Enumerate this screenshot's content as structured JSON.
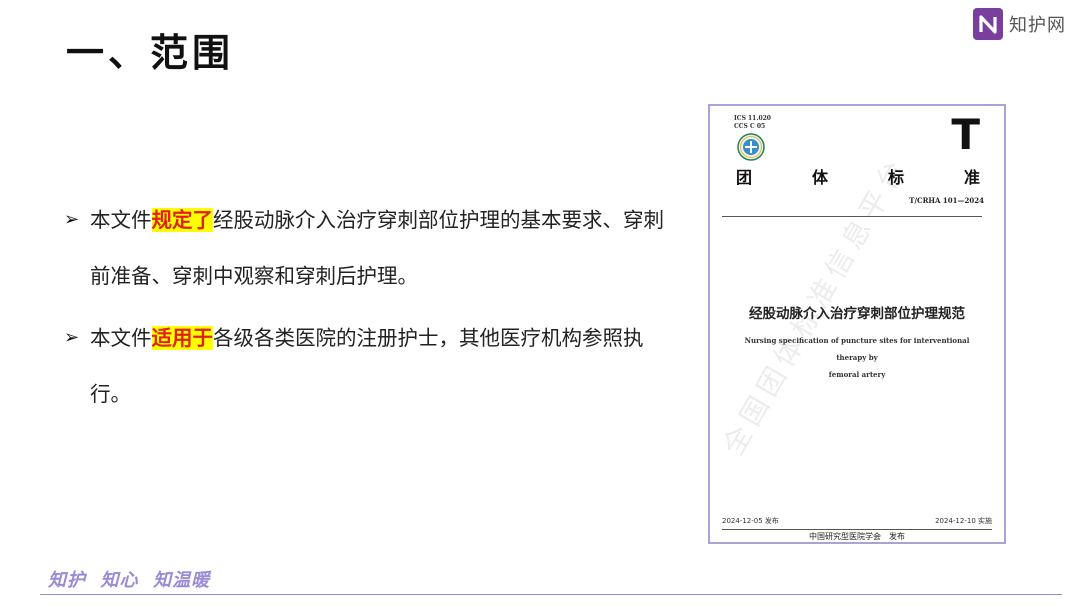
{
  "slide": {
    "title": "一、范围"
  },
  "logo": {
    "mark": "N",
    "text": "知护网",
    "icon": "zhihu-logo-icon",
    "color": "#7a3f9c"
  },
  "bullets": [
    {
      "before": "本文件",
      "highlight": "规定了",
      "after": "经股动脉介入治疗穿刺部位护理的基本要求、穿刺前准备、穿刺中观察和穿刺后护理。"
    },
    {
      "before": "本文件",
      "highlight": "适用于",
      "after": "各级各类医院的注册护士，其他医疗机构参照执行。"
    }
  ],
  "bullet_marker": "➢",
  "highlight_colors": {
    "background": "#ffff00",
    "text": "#e0201b"
  },
  "document": {
    "ics": "ICS 11.020",
    "ccs": "CCS C 05",
    "category_letter": "T",
    "category": [
      "团",
      "体",
      "标",
      "准"
    ],
    "standard_no": "T/CRHA 101—2024",
    "title_cn": "经股动脉介入治疗穿刺部位护理规范",
    "title_en_line1": "Nursing specification of puncture sites for interventional therapy by",
    "title_en_line2": "femoral artery",
    "publish_date": "2024-12-05 发布",
    "effective_date": "2024-12-10 实施",
    "publisher": "中国研究型医院学会　发布",
    "watermark": "全国团体标准信息平台"
  },
  "footer": {
    "slogan": "知护  知心  知温暖",
    "accent": "#9b8bd6"
  }
}
